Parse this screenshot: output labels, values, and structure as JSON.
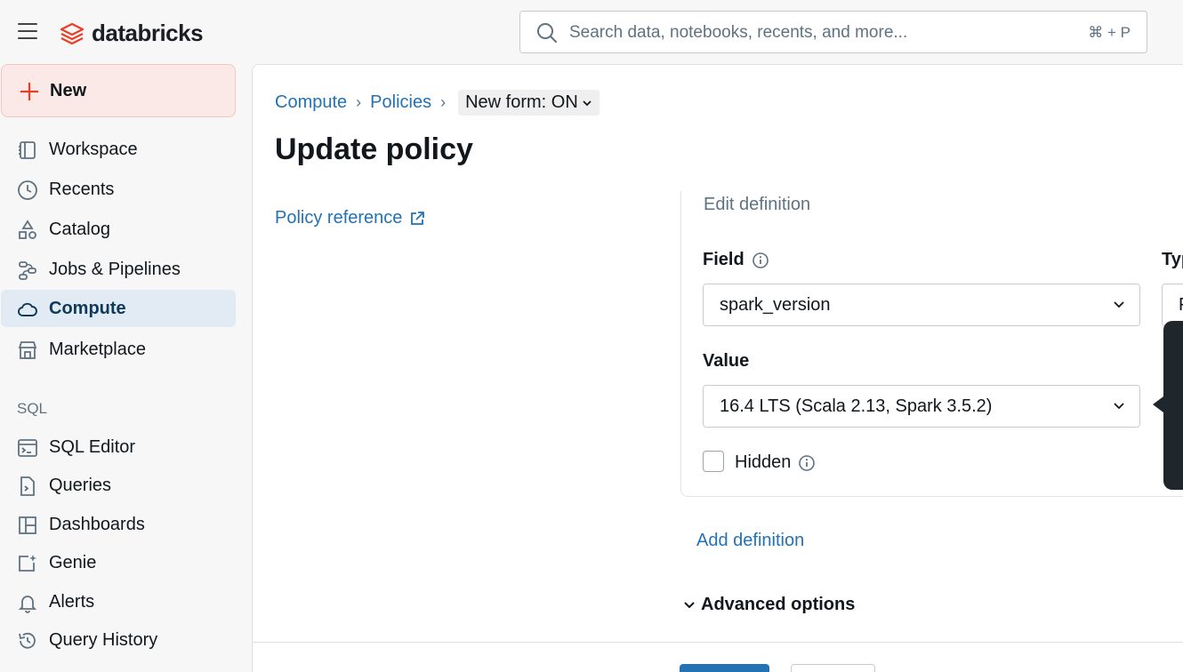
{
  "header": {
    "logo_text": "databricks",
    "search": {
      "placeholder": "Search data, notebooks, recents, and more...",
      "shortcut": "⌘ + P"
    }
  },
  "sidebar": {
    "new_label": "New",
    "items": [
      {
        "label": "Workspace",
        "icon": "workspace-icon"
      },
      {
        "label": "Recents",
        "icon": "clock-icon"
      },
      {
        "label": "Catalog",
        "icon": "catalog-icon"
      },
      {
        "label": "Jobs & Pipelines",
        "icon": "workflow-icon"
      },
      {
        "label": "Compute",
        "icon": "cloud-icon",
        "active": true
      },
      {
        "label": "Marketplace",
        "icon": "store-icon"
      }
    ],
    "sql_section_label": "SQL",
    "sql_items": [
      {
        "label": "SQL Editor",
        "icon": "sql-editor-icon"
      },
      {
        "label": "Queries",
        "icon": "query-file-icon"
      },
      {
        "label": "Dashboards",
        "icon": "dashboard-icon"
      },
      {
        "label": "Genie",
        "icon": "genie-icon"
      },
      {
        "label": "Alerts",
        "icon": "bell-icon"
      },
      {
        "label": "Query History",
        "icon": "history-icon"
      }
    ]
  },
  "main": {
    "breadcrumb": [
      "Compute",
      "Policies"
    ],
    "new_form_toggle": "New form: ON",
    "title": "Update policy",
    "policy_reference": "Policy reference",
    "definition": {
      "title": "Edit definition",
      "field_label": "Field",
      "field_value": "spark_version",
      "type_label": "Typ",
      "type_value": "F",
      "value_label": "Value",
      "value_value": "16.4 LTS (Scala 2.13, Spark 3.5.2)",
      "hidden_label": "Hidden",
      "hidden_checked": false
    },
    "add_definition": "Add definition",
    "advanced_options": "Advanced options"
  },
  "colors": {
    "accent": "#2272b4",
    "new_button_bg": "#fbe9e7",
    "active_nav_bg": "#e2ebf3",
    "brand_red": "#eb3c25"
  }
}
